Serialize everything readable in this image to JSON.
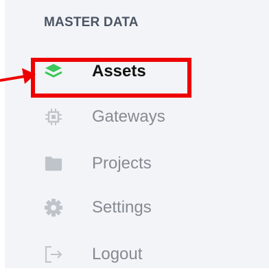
{
  "sidebar": {
    "section_title": "MASTER DATA",
    "items": [
      {
        "label": "Assets",
        "icon": "layers-icon",
        "active": true
      },
      {
        "label": "Gateways",
        "icon": "chip-icon",
        "active": false
      },
      {
        "label": "Projects",
        "icon": "folder-icon",
        "active": false
      },
      {
        "label": "Settings",
        "icon": "gear-icon",
        "active": false
      },
      {
        "label": "Logout",
        "icon": "logout-icon",
        "active": false
      }
    ]
  },
  "colors": {
    "active_icon": "#3cc85a",
    "inactive_icon": "#bfc3ca",
    "inactive_text": "#858a93",
    "annotation": "#ee0000",
    "sidebar_background": "#f3f4f7"
  }
}
